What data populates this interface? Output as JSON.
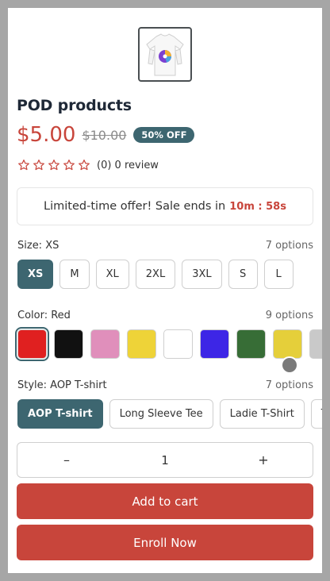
{
  "product": {
    "title": "POD products",
    "price": "$5.00",
    "old_price": "$10.00",
    "discount_badge": "50% OFF",
    "rating": {
      "stars_filled": 0,
      "stars_total": 5,
      "text": "(0) 0 review"
    }
  },
  "offer": {
    "text": "Limited-time offer! Sale ends in",
    "timer": "10m : 58s"
  },
  "size": {
    "label": "Size: XS",
    "count": "7 options",
    "options": [
      "XS",
      "M",
      "XL",
      "2XL",
      "3XL",
      "S",
      "L"
    ],
    "selected_index": 0
  },
  "color": {
    "label": "Color: Red",
    "count": "9 options",
    "swatches": [
      "#e02020",
      "#111111",
      "#e08fbb",
      "#eed338",
      "#ffffff",
      "#3d26e6",
      "#376d36",
      "#e5cf3a",
      "#c9c9c9"
    ],
    "selected_index": 0
  },
  "style": {
    "label": "Style: AOP T-shirt",
    "count": "7 options",
    "options": [
      "AOP T-shirt",
      "Long Sleeve Tee",
      "Ladie T-Shirt",
      "T"
    ],
    "selected_index": 0
  },
  "quantity": {
    "minus": "–",
    "value": "1",
    "plus": "+"
  },
  "actions": {
    "add_to_cart": "Add to cart",
    "enroll": "Enroll Now"
  },
  "colors": {
    "accent": "#3d6670",
    "cta": "#c8453b",
    "star": "#c8453b"
  },
  "icons": {
    "star": "star-outline-icon",
    "product": "tshirt-thumbnail-icon"
  }
}
